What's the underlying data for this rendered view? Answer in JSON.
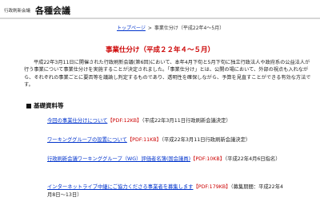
{
  "header": {
    "small_text": "行政刷新会議",
    "title": "各種会議"
  },
  "breadcrumb": {
    "top": "トップページ",
    "separator": ">",
    "current": "事業仕分け（平成22年4〜5月）"
  },
  "page_title": "事業仕分け（平成２２年４〜５月）",
  "intro": "平成22年3月11日に開催された行政刷新会議(第6回)において、本年4月下旬と5月下旬に独立行政法人や政府系の公益法人が行う事業について事業仕分けを実施することが決定されました。「事業仕分け」とは、公開の場において、外部の視点も入れながら、それぞれの事業ごとに要否等を議論し判定するものであり、透明性を確保しながら、予算を見直すことができる有効な方法です。",
  "section_heading": "基礎資料等",
  "items": [
    {
      "link": "今回の事業仕分けについて",
      "pdf": "【PDF:12KB】",
      "note": "（平成22年3月11日行政刷新会議決定）"
    },
    {
      "link": "ワーキンググループの設置について",
      "pdf": "【PDF:11KB】",
      "note": "（平成22年3月11日行政刷新会議決定）"
    },
    {
      "link": "行政刷新会議ワーキンググループ（WG）評価者名簿(国会議員)",
      "pdf": "【PDF:10KB】",
      "note": "（平成22年4月6日指名）"
    },
    {
      "link": "インターネットライブ中継にご協力くださる事業者を募集します",
      "pdf": "【PDF:179KB】",
      "note": "（募集期間：平成22年4月8日〜13日）"
    }
  ]
}
